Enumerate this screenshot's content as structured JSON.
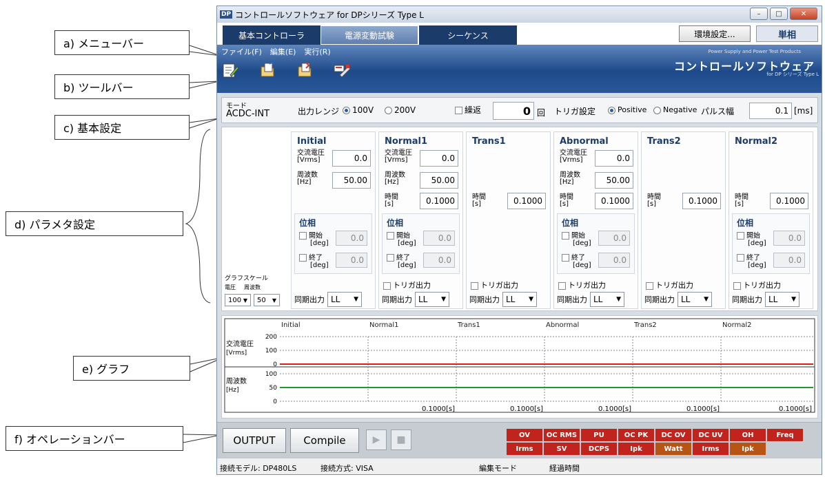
{
  "callouts": [
    "a) メニューバー",
    "b) ツールバー",
    "c) 基本設定",
    "d) パラメタ設定",
    "e) グラフ",
    "f) オペレーションバー"
  ],
  "window": {
    "icon_text": "DP",
    "title": "コントロールソフトウェア for DPシリーズ Type L",
    "min_glyph": "–",
    "max_glyph": "□",
    "close_glyph": "✕"
  },
  "tabs": [
    "基本コントローラ",
    "電源変動試験",
    "シーケンス"
  ],
  "env_button": "環境設定...",
  "phase_button": "単相",
  "menu": [
    "ファイル(F)",
    "編集(E)",
    "実行(R)"
  ],
  "toolbar_icons": [
    "edit-icon",
    "open-file-icon",
    "save-file-icon",
    "transfer-icon"
  ],
  "brand": {
    "line1": "Power Supply and Power Test Products",
    "line2": "コントロールソフトウェア",
    "line3": "for DP シリーズ Type L"
  },
  "basic": {
    "mode_label": "モード",
    "mode_value": "ACDC-INT",
    "range_label": "出力レンジ",
    "range_opts": [
      "100V",
      "200V"
    ],
    "repeat_label": "繰返",
    "repeat_value": "0",
    "repeat_unit": "回",
    "trigger_label": "トリガ設定",
    "trigger_opts": [
      "Positive",
      "Negative"
    ],
    "pulse_label": "パルス幅",
    "pulse_value": "0.1",
    "pulse_unit": "[ms]"
  },
  "graph_scale": {
    "label": "グラフスケール",
    "voltage_label": "電圧",
    "freq_label": "周波数",
    "voltage_value": "100",
    "freq_value": "50"
  },
  "labels": {
    "ac_voltage": "交流電圧",
    "ac_voltage_unit": "[Vrms]",
    "frequency": "周波数",
    "frequency_unit": "[Hz]",
    "time": "時間",
    "time_unit": "[s]",
    "phase": "位相",
    "start": "開始",
    "end": "終了",
    "deg": "[deg]",
    "trigger_out": "トリガ出力",
    "sync_out": "同期出力",
    "select_arrow": "▼"
  },
  "steps": [
    {
      "name": "Initial",
      "voltage": "0.0",
      "freq": "50.00",
      "phase_start": "0.0",
      "phase_end": "0.0",
      "sync": "LL"
    },
    {
      "name": "Normal1",
      "voltage": "0.0",
      "freq": "50.00",
      "time": "0.1000",
      "phase_start": "0.0",
      "phase_end": "0.0",
      "sync": "LL"
    },
    {
      "name": "Trans1",
      "time": "0.1000",
      "sync": "LL"
    },
    {
      "name": "Abnormal",
      "voltage": "0.0",
      "freq": "50.00",
      "time": "0.1000",
      "phase_start": "0.0",
      "phase_end": "0.0",
      "sync": "LL"
    },
    {
      "name": "Trans2",
      "time": "0.1000",
      "sync": "LL"
    },
    {
      "name": "Normal2",
      "time": "0.1000",
      "phase_start": "0.0",
      "phase_end": "0.0",
      "sync": "LL"
    }
  ],
  "graph": {
    "step_labels": [
      "Initial",
      "Normal1",
      "Trans1",
      "Abnormal",
      "Trans2",
      "Normal2"
    ],
    "voltage_label": "交流電圧",
    "voltage_unit": "[Vrms]",
    "voltage_ticks": [
      "200",
      "100",
      "0"
    ],
    "freq_label": "周波数",
    "freq_unit": "[Hz]",
    "freq_ticks": [
      "100",
      "50",
      "0"
    ],
    "time_labels": [
      "0.1000[s]",
      "0.1000[s]",
      "0.1000[s]",
      "0.1000[s]",
      "0.1000[s]"
    ],
    "voltage_color": "#d81e1e",
    "freq_color": "#1f9a2c"
  },
  "opbar": {
    "output": "OUTPUT",
    "compile": "Compile",
    "play_glyph": "▶",
    "stop_glyph": "■",
    "alarms_row1": [
      "OV",
      "OC RMS",
      "PU",
      "OC PK",
      "DC OV",
      "DC UV",
      "OH",
      "Freq"
    ],
    "alarms_row2": [
      "Irms",
      "SV",
      "DCPS",
      "Ipk",
      "Watt",
      "Irms",
      "Ipk"
    ],
    "alarm_red": "#c0241c",
    "alarm_orange": "#b85414"
  },
  "status": {
    "model": "接続モデル: DP480LS",
    "method": "接続方式: VISA",
    "edit_mode": "編集モード",
    "elapsed": "経過時間"
  }
}
